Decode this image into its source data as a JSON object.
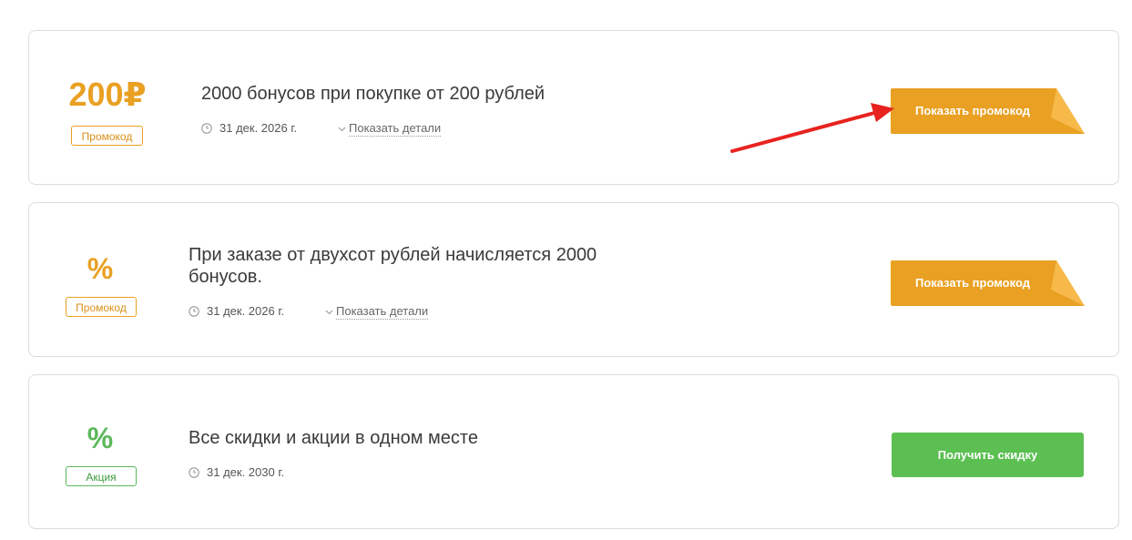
{
  "offers": [
    {
      "discount": "200₽",
      "badge": "Промокод",
      "title": "2000 бонусов при покупке от 200 рублей",
      "date": "31 дек. 2026 г.",
      "details_label": "Показать детали",
      "button_label": "Показать промокод",
      "color": "#e9a023"
    },
    {
      "discount": "%",
      "badge": "Промокод",
      "title_line1": "При заказе от двухсот рублей начисляется 2000",
      "title_line2": "бонусов.",
      "date": "31 дек. 2026 г.",
      "details_label": "Показать детали",
      "button_label": "Показать промокод",
      "color": "#e9a023"
    },
    {
      "discount": "%",
      "badge": "Акция",
      "title": "Все скидки и акции в одном месте",
      "date": "31 дек. 2030 г.",
      "button_label": "Получить скидку",
      "color": "#5bbf52"
    }
  ],
  "annotation": {
    "arrow_color": "#e8231f"
  }
}
